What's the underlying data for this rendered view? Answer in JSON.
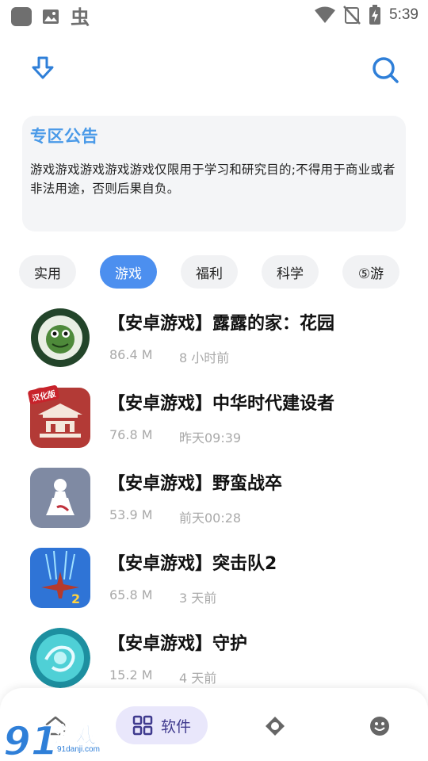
{
  "status_bar": {
    "time": "5:39"
  },
  "header": {
    "download_icon": "download-arrow-icon",
    "search_icon": "search-icon"
  },
  "notice": {
    "title": "专区公告",
    "body": "游戏游戏游戏游戏游戏仅限用于学习和研究目的;不得用于商业或者非法用途，否则后果自负。"
  },
  "tabs": [
    {
      "label": "实用",
      "active": false
    },
    {
      "label": "游戏",
      "active": true
    },
    {
      "label": "福利",
      "active": false
    },
    {
      "label": "科学",
      "active": false
    },
    {
      "label": "⑤游",
      "active": false
    }
  ],
  "apps": [
    {
      "title": "【安卓游戏】露露的家：花园",
      "size": "86.4 M",
      "time": "8 小时前",
      "icon": "plant-flowers-frog-icon",
      "badge": ""
    },
    {
      "title": "【安卓游戏】中华时代建设者",
      "size": "76.8 M",
      "time": "昨天09:39",
      "icon": "chinese-palace-icon",
      "badge": "汉化版"
    },
    {
      "title": "【安卓游戏】野蛮战卒",
      "size": "53.9 M",
      "time": "前天00:28",
      "icon": "chess-pawn-icon",
      "badge": ""
    },
    {
      "title": "【安卓游戏】突击队2",
      "size": "65.8 M",
      "time": "3 天前",
      "icon": "fighter-plane-icon",
      "badge": ""
    },
    {
      "title": "【安卓游戏】守护",
      "size": "15.2 M",
      "time": "4 天前",
      "icon": "blue-orb-icon",
      "badge": ""
    }
  ],
  "bottom_nav": {
    "home_icon": "home-icon",
    "active_label": "软件",
    "active_icon": "grid-apps-icon",
    "third_icon": "disc-icon",
    "fourth_icon": "smiley-icon"
  },
  "watermark": {
    "text": "游戏",
    "url": "91danji.com",
    "number": "91"
  },
  "colors": {
    "accent": "#4c8fef",
    "notice_title": "#4a9ae8",
    "nav_active_bg": "#e9e7fb",
    "nav_active_fg": "#3f3a8e"
  }
}
